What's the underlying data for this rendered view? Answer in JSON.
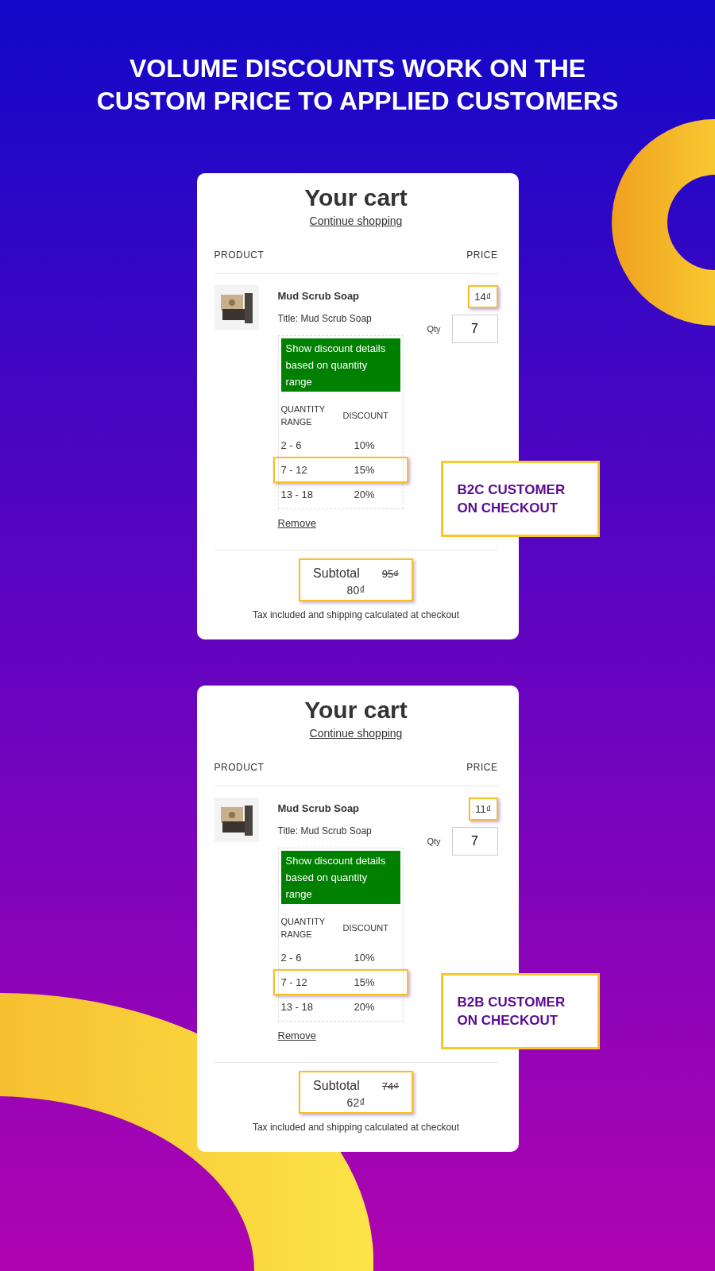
{
  "headline": "VOLUME DISCOUNTS WORK ON THE CUSTOM PRICE TO APPLIED CUSTOMERS",
  "carts": [
    {
      "title": "Your cart",
      "continue_link": "Continue shopping",
      "columns": {
        "product": "PRODUCT",
        "price": "PRICE"
      },
      "item": {
        "name": "Mud Scrub Soap",
        "variant": "Title: Mud Scrub Soap",
        "price": "14₫",
        "qty_label": "Qty",
        "qty": "7",
        "discount_toggle": "Show discount details based on quantity range",
        "table": {
          "columns": [
            "QUANTITY RANGE",
            "DISCOUNT"
          ],
          "rows": [
            {
              "range": "2 - 6",
              "discount": "10%",
              "selected": false
            },
            {
              "range": "7 - 12",
              "discount": "15%",
              "selected": true
            },
            {
              "range": "13 - 18",
              "discount": "20%",
              "selected": false
            }
          ]
        },
        "remove": "Remove"
      },
      "subtotal_label": "Subtotal",
      "original_subtotal": "95₫",
      "subtotal": "80₫",
      "tax_note": "Tax included and shipping calculated at checkout",
      "callout": "B2C CUSTOMER ON CHECKOUT"
    },
    {
      "title": "Your cart",
      "continue_link": "Continue shopping",
      "columns": {
        "product": "PRODUCT",
        "price": "PRICE"
      },
      "item": {
        "name": "Mud Scrub Soap",
        "variant": "Title: Mud Scrub Soap",
        "price": "11₫",
        "qty_label": "Qty",
        "qty": "7",
        "discount_toggle": "Show discount details based on quantity range",
        "table": {
          "columns": [
            "QUANTITY RANGE",
            "DISCOUNT"
          ],
          "rows": [
            {
              "range": "2 - 6",
              "discount": "10%",
              "selected": false
            },
            {
              "range": "7 - 12",
              "discount": "15%",
              "selected": true
            },
            {
              "range": "13 - 18",
              "discount": "20%",
              "selected": false
            }
          ]
        },
        "remove": "Remove"
      },
      "subtotal_label": "Subtotal",
      "original_subtotal": "74₫",
      "subtotal": "62₫",
      "tax_note": "Tax included and shipping calculated at checkout",
      "callout": "B2B CUSTOMER ON CHECKOUT"
    }
  ]
}
